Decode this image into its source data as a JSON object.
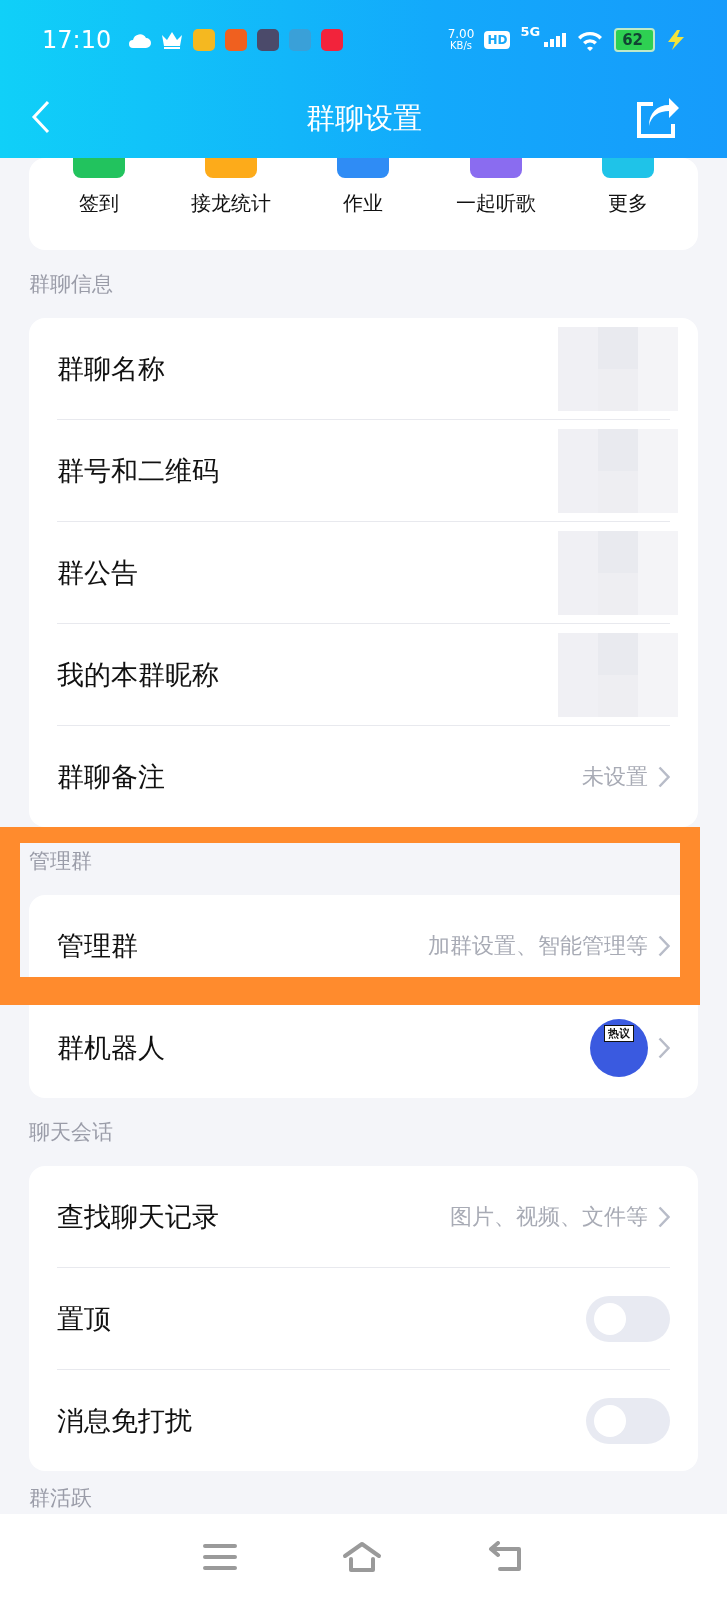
{
  "status_bar": {
    "time": "17:10",
    "net_speed": "7.00",
    "net_unit": "KB/s",
    "hd": "HD",
    "network": "5G",
    "battery": "62"
  },
  "header": {
    "title": "群聊设置"
  },
  "quick_actions": [
    {
      "label": "签到",
      "color": "#22c35e"
    },
    {
      "label": "接龙统计",
      "color": "#fdab1a"
    },
    {
      "label": "作业",
      "color": "#2f8cf5"
    },
    {
      "label": "一起听歌",
      "color": "#8a6cf0"
    },
    {
      "label": "更多",
      "color": "#1fc3e8"
    }
  ],
  "sections": [
    {
      "title": "群聊信息",
      "rows": [
        {
          "kind": "link",
          "label": "群聊名称",
          "redacted": true
        },
        {
          "kind": "link",
          "label": "群号和二维码",
          "redacted": true
        },
        {
          "kind": "link",
          "label": "群公告",
          "redacted": true
        },
        {
          "kind": "link",
          "label": "我的本群昵称",
          "redacted": true
        },
        {
          "kind": "link",
          "label": "群聊备注",
          "value": "未设置"
        }
      ]
    },
    {
      "title": "管理群",
      "highlight": true,
      "rows": [
        {
          "kind": "link",
          "label": "管理群",
          "value": "加群设置、智能管理等"
        },
        {
          "kind": "avatar",
          "label": "群机器人",
          "badge": "热议"
        }
      ]
    },
    {
      "title": "聊天会话",
      "rows": [
        {
          "kind": "link",
          "label": "查找聊天记录",
          "value": "图片、视频、文件等"
        },
        {
          "kind": "toggle",
          "label": "置顶",
          "on": false
        },
        {
          "kind": "toggle",
          "label": "消息免打扰",
          "on": false
        }
      ]
    },
    {
      "title": "群活跃"
    }
  ]
}
